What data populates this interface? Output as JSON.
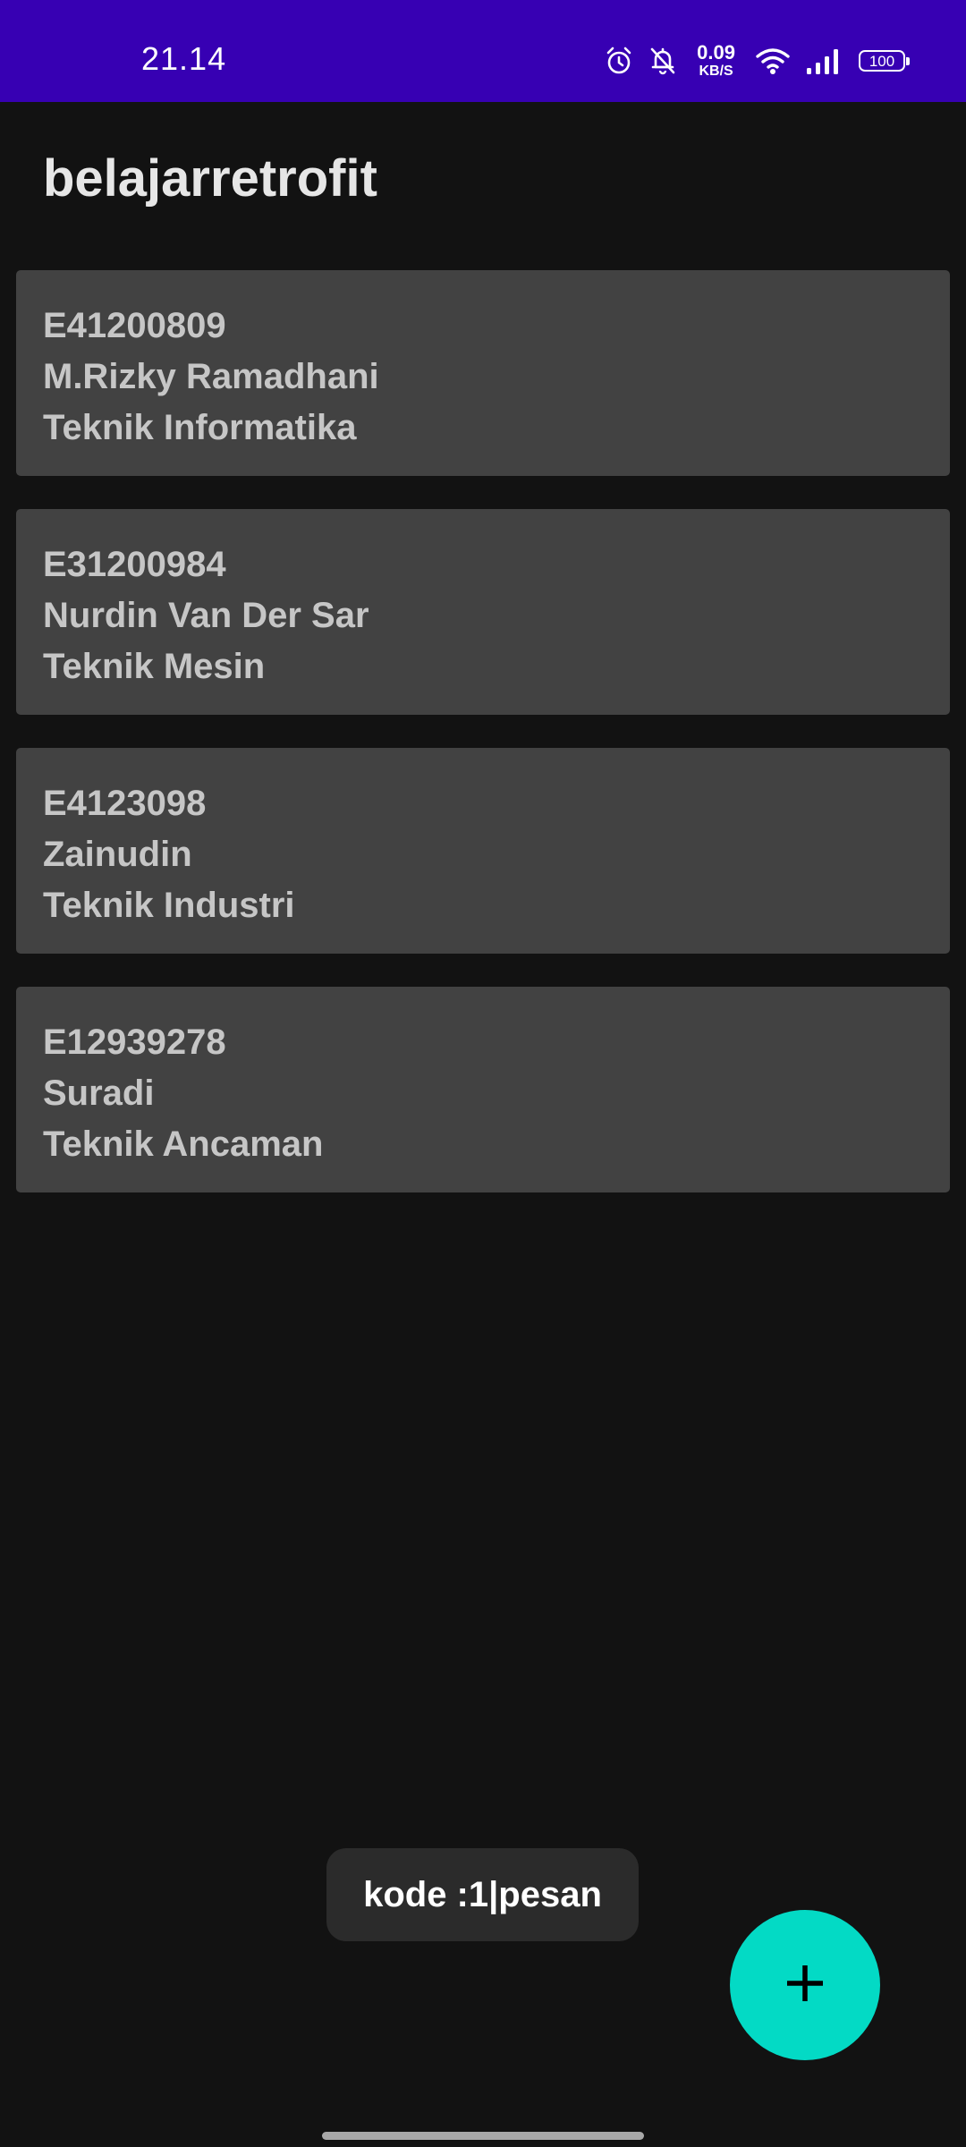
{
  "status_bar": {
    "time": "21.14",
    "net_speed_value": "0.09",
    "net_speed_unit": "KB/S",
    "battery_level": "100",
    "icons": [
      "alarm-icon",
      "notifications-off-icon",
      "wifi-icon",
      "signal-icon",
      "battery-icon"
    ],
    "background_color": "#3700b3"
  },
  "app_bar": {
    "title": "belajarretrofit"
  },
  "students": [
    {
      "nim": "E41200809",
      "name": "M.Rizky Ramadhani",
      "major": "Teknik Informatika"
    },
    {
      "nim": "E31200984",
      "name": "Nurdin Van Der Sar",
      "major": "Teknik Mesin"
    },
    {
      "nim": "E4123098",
      "name": "Zainudin",
      "major": "Teknik Industri"
    },
    {
      "nim": "E12939278",
      "name": "Suradi",
      "major": "Teknik Ancaman"
    }
  ],
  "toast": {
    "message": "kode :1|pesan"
  },
  "fab": {
    "icon": "add-icon",
    "color": "#03dac5"
  },
  "theme": {
    "background": "#121212",
    "card": "#424242"
  }
}
